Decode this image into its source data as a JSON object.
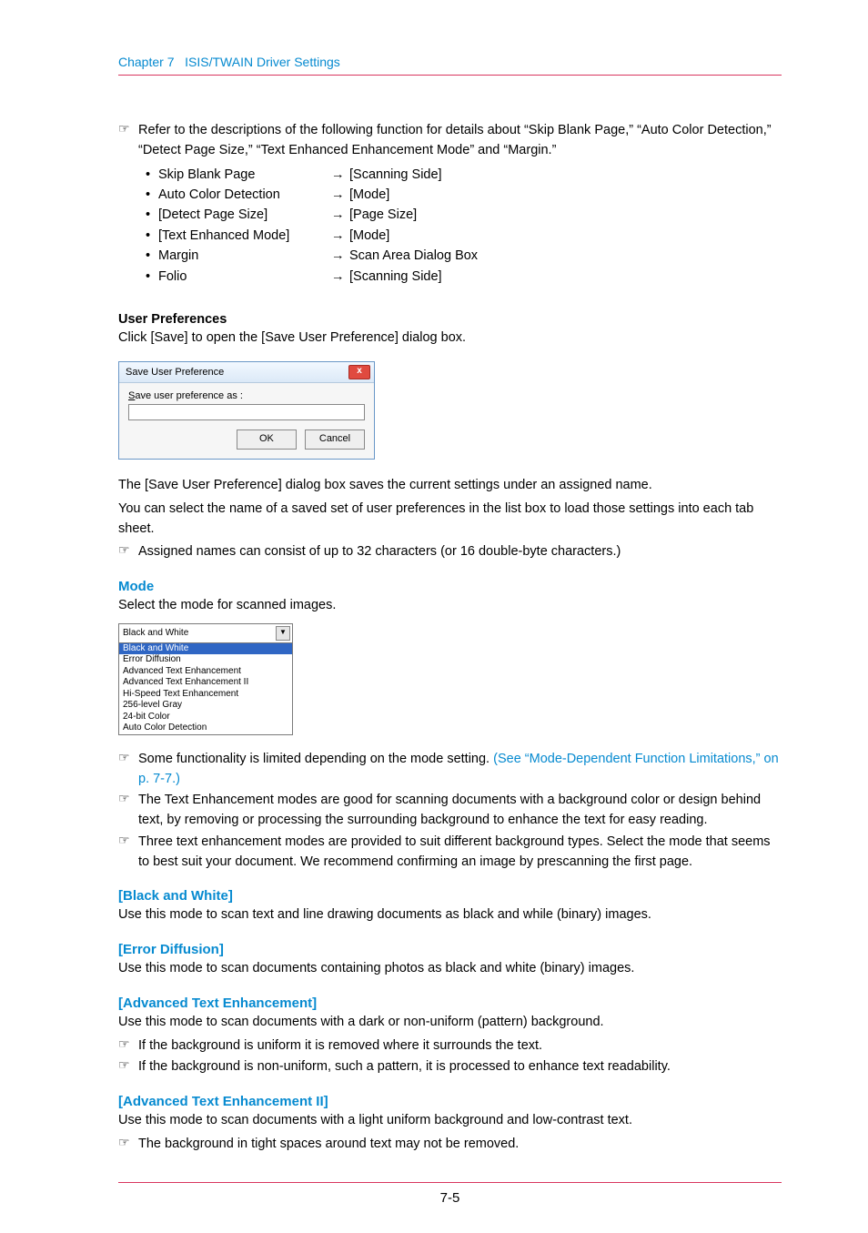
{
  "header": {
    "chapter": "Chapter 7",
    "title": "ISIS/TWAIN Driver Settings"
  },
  "intro": "Refer to the descriptions of the following function for details about “Skip Blank Page,” “Auto Color Detection,” “Detect Page Size,” “Text Enhanced Enhancement Mode” and “Margin.”",
  "refs": [
    {
      "left": "Skip Blank Page",
      "right": "[Scanning Side]"
    },
    {
      "left": "Auto Color Detection",
      "right": "[Mode]"
    },
    {
      "left": "[Detect Page Size]",
      "right": "[Page Size]"
    },
    {
      "left": "[Text Enhanced Mode]",
      "right": "[Mode]"
    },
    {
      "left": "Margin",
      "right": "Scan Area Dialog Box"
    },
    {
      "left": "Folio",
      "right": "[Scanning Side]"
    }
  ],
  "userPrefs": {
    "heading": "User Preferences",
    "line1": "Click [Save] to open the [Save User Preference] dialog box.",
    "dialog": {
      "title": "Save User Preference",
      "close": "x",
      "label_prefix": "S",
      "label_rest": "ave user preference as :",
      "ok": "OK",
      "cancel": "Cancel"
    },
    "after1": "The [Save User Preference] dialog box saves the current settings under an assigned name.",
    "after2": "You can select the name of a saved set of user preferences in the list box to load those settings into each tab sheet.",
    "note": "Assigned names can consist of up to 32 characters (or 16 double-byte characters.)"
  },
  "mode": {
    "heading": "Mode",
    "line1": "Select the mode for scanned images.",
    "selected": "Black and White",
    "options": [
      "Black and White",
      "Error Diffusion",
      "Advanced Text Enhancement",
      "Advanced Text Enhancement II",
      "Hi-Speed Text Enhancement",
      "256-level Gray",
      "24-bit Color",
      "Auto Color Detection"
    ],
    "note1a": "Some functionality is limited depending on the mode setting. ",
    "note1b": "(See “Mode-Dependent Function Limitations,” on p. 7-7.)",
    "note2": "The Text Enhancement modes are good for scanning documents with a background color or design behind text, by removing or processing the surrounding background to enhance the text for easy reading.",
    "note3": "Three text enhancement modes are provided to suit different background types.  Select the mode that seems to best suit your document. We recommend confirming an image by prescanning the first page."
  },
  "bw": {
    "heading": "[Black and White]",
    "body": "Use this mode to scan text and line drawing documents as black and while (binary) images."
  },
  "ed": {
    "heading": "[Error Diffusion]",
    "body": "Use this mode to scan documents containing photos as black and white (binary) images."
  },
  "ate": {
    "heading": "[Advanced Text Enhancement]",
    "body": "Use this mode to scan documents with a dark or non-uniform (pattern) background.",
    "n1": "If the background is uniform it is removed where it surrounds the text.",
    "n2": "If the background is non-uniform, such a pattern, it is processed to enhance text readability."
  },
  "ate2": {
    "heading": "[Advanced Text Enhancement II]",
    "body": "Use this mode to scan documents with a light uniform background and low-contrast text.",
    "n1": "The background in tight spaces around text may not be removed."
  },
  "footer": "7-5"
}
